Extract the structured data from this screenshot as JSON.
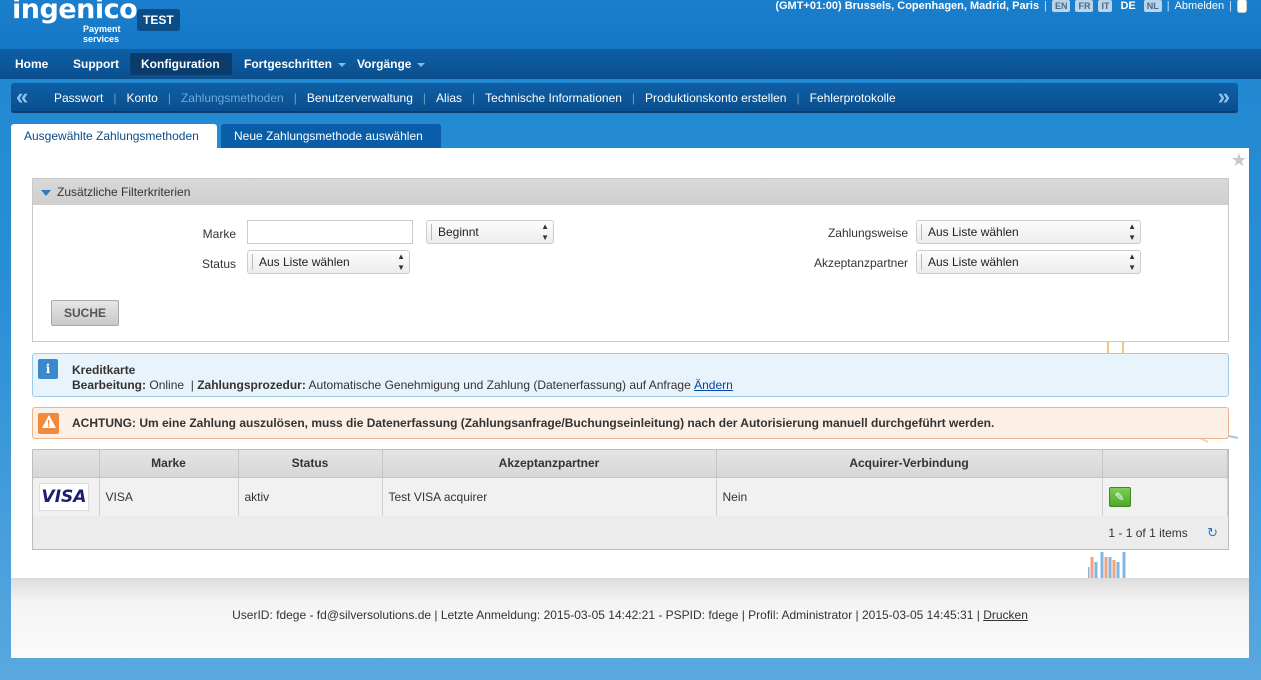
{
  "header": {
    "logo": "ingenico",
    "logo_sub_1": "Payment",
    "logo_sub_2": "services",
    "env_badge": "TEST",
    "timezone": "(GMT+01:00) Brussels, Copenhagen, Madrid, Paris",
    "languages": [
      "EN",
      "FR",
      "IT",
      "DE",
      "NL"
    ],
    "active_language": "DE",
    "logout": "Abmelden"
  },
  "mainnav": {
    "home": "Home",
    "support": "Support",
    "konfiguration": "Konfiguration",
    "fortgeschritten": "Fortgeschritten",
    "vorgaenge": "Vorgänge"
  },
  "subnav": {
    "items": [
      "Passwort",
      "Konto",
      "Zahlungsmethoden",
      "Benutzerverwaltung",
      "Alias",
      "Technische Informationen",
      "Produktionskonto erstellen",
      "Fehlerprotokolle"
    ],
    "current": "Zahlungsmethoden"
  },
  "tabs": {
    "selected": "Ausgewählte Zahlungsmethoden",
    "new": "Neue Zahlungsmethode auswählen"
  },
  "filter": {
    "header": "Zusätzliche Filterkriterien",
    "marke_label": "Marke",
    "marke_value": "",
    "marke_mode": "Beginnt",
    "status_label": "Status",
    "status_value": "Aus Liste wählen",
    "zahlungsweise_label": "Zahlungsweise",
    "zahlungsweise_value": "Aus Liste wählen",
    "akzeptanzpartner_label": "Akzeptanzpartner",
    "akzeptanzpartner_value": "Aus Liste wählen",
    "search_button": "SUCHE"
  },
  "info": {
    "title": "Kreditkarte",
    "bearbeitung_label": "Bearbeitung:",
    "bearbeitung_value": "Online",
    "sep": "|",
    "prozedur_label": "Zahlungsprozedur:",
    "prozedur_value": "Automatische Genehmigung und Zahlung (Datenerfassung) auf Anfrage",
    "change_link": "Ändern"
  },
  "warning": {
    "text": "ACHTUNG: Um eine Zahlung auszulösen, muss die Datenerfassung (Zahlungsanfrage/Buchungseinleitung) nach der Autorisierung manuell durchgeführt werden."
  },
  "grid": {
    "columns": [
      "",
      "Marke",
      "Status",
      "Akzeptanzpartner",
      "Acquirer-Verbindung",
      ""
    ],
    "rows": [
      {
        "logo": "VISA",
        "marke": "VISA",
        "status": "aktiv",
        "partner": "Test VISA acquirer",
        "acquirer": "Nein"
      }
    ],
    "pager": "1 - 1 of 1 items"
  },
  "footer": {
    "text": "UserID: fdege - fd@silversolutions.de | Letzte Anmeldung: 2015-03-05 14:42:21 - PSPID: fdege | Profil: Administrator | 2015-03-05 14:45:31 |",
    "print_link": "Drucken"
  },
  "colors": {
    "brand_blue": "#1a7fcc",
    "nav_dark": "#0a4f8e",
    "accent_green": "#4ea72a",
    "warning_orange": "#f08a3c"
  }
}
